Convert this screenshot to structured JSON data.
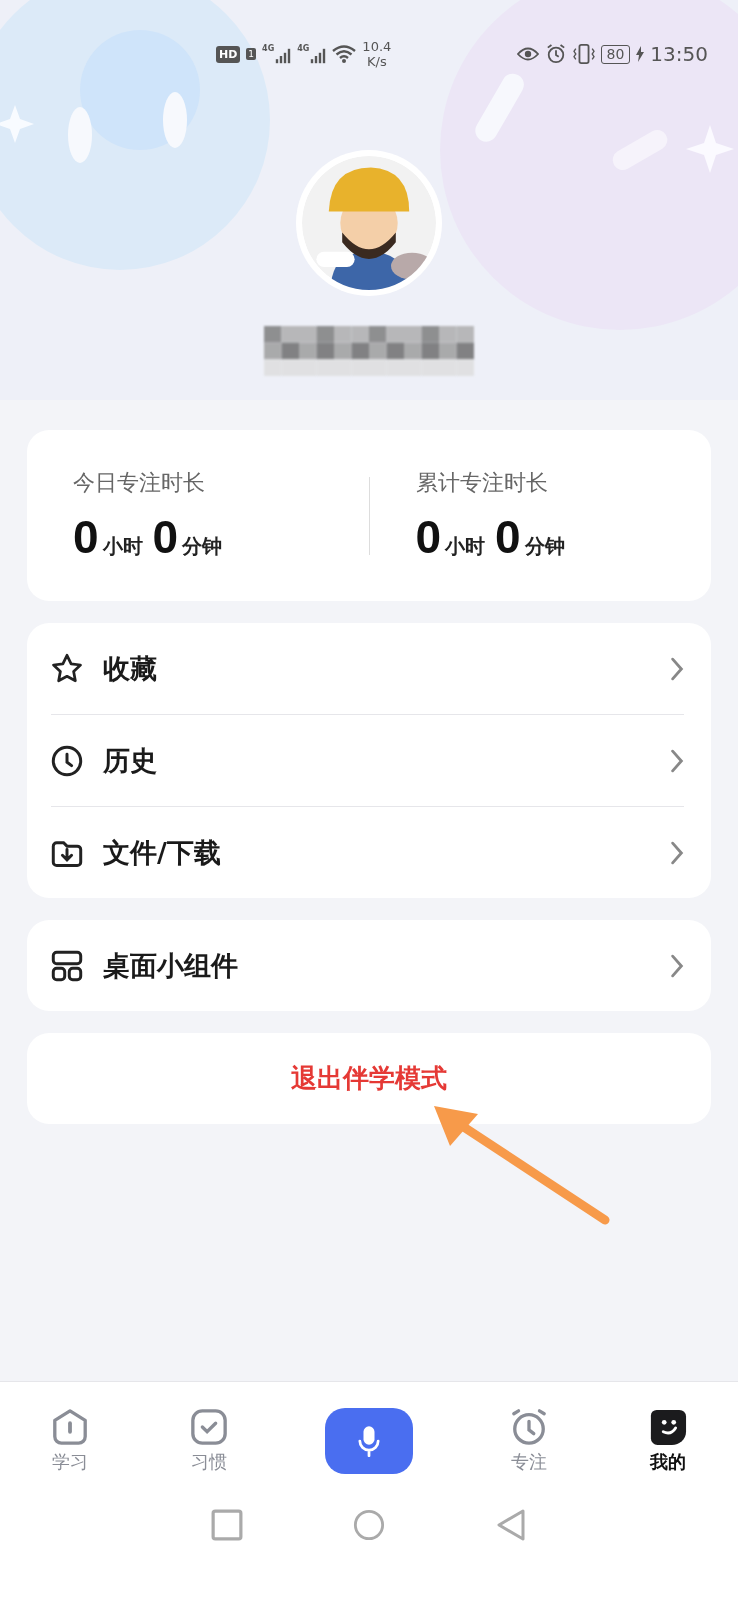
{
  "status_bar": {
    "hd": "HD",
    "sim": "1",
    "networks": [
      "4G",
      "4G"
    ],
    "speed": "10.4",
    "speed_unit": "K/s",
    "battery": "80",
    "time": "13:50"
  },
  "stats": [
    {
      "label": "今日专注时长",
      "hours": "0",
      "hours_unit": "小时",
      "minutes": "0",
      "minutes_unit": "分钟"
    },
    {
      "label": "累计专注时长",
      "hours": "0",
      "hours_unit": "小时",
      "minutes": "0",
      "minutes_unit": "分钟"
    }
  ],
  "menu_groups": [
    [
      {
        "kind": "star",
        "label": "收藏"
      },
      {
        "kind": "clock",
        "label": "历史"
      },
      {
        "kind": "download",
        "label": "文件/下载"
      }
    ],
    [
      {
        "kind": "widget",
        "label": "桌面小组件"
      }
    ]
  ],
  "exit_button": "退出伴学模式",
  "nav": [
    {
      "kind": "study",
      "label": "学习",
      "selected": false
    },
    {
      "kind": "habit",
      "label": "习惯",
      "selected": false
    },
    {
      "kind": "mic",
      "selected": false
    },
    {
      "kind": "focus",
      "label": "专注",
      "selected": false
    },
    {
      "kind": "me",
      "label": "我的",
      "selected": true
    }
  ]
}
